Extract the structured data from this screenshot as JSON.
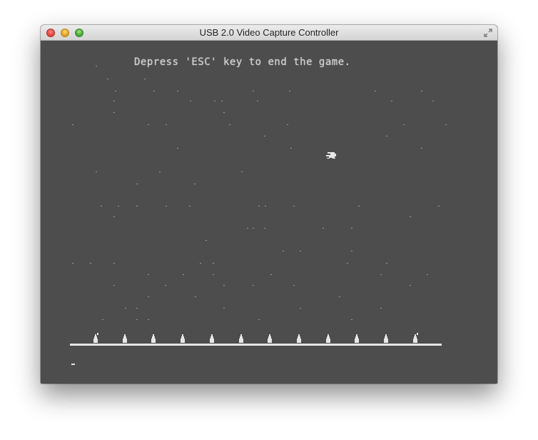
{
  "window": {
    "title": "USB 2.0 Video Capture Controller",
    "controls": [
      "close-icon",
      "minimize-icon",
      "zoom-icon",
      "fullscreen-icon"
    ]
  },
  "game": {
    "message": "Depress 'ESC' key to end the game.",
    "colors": {
      "background": "#4d4d4d",
      "foreground": "#e6e6e6",
      "message": "#cfcfcf"
    },
    "ground_units": 12,
    "sprites": [
      "ship-icon",
      "turret-icon",
      "cursor-mark"
    ]
  }
}
